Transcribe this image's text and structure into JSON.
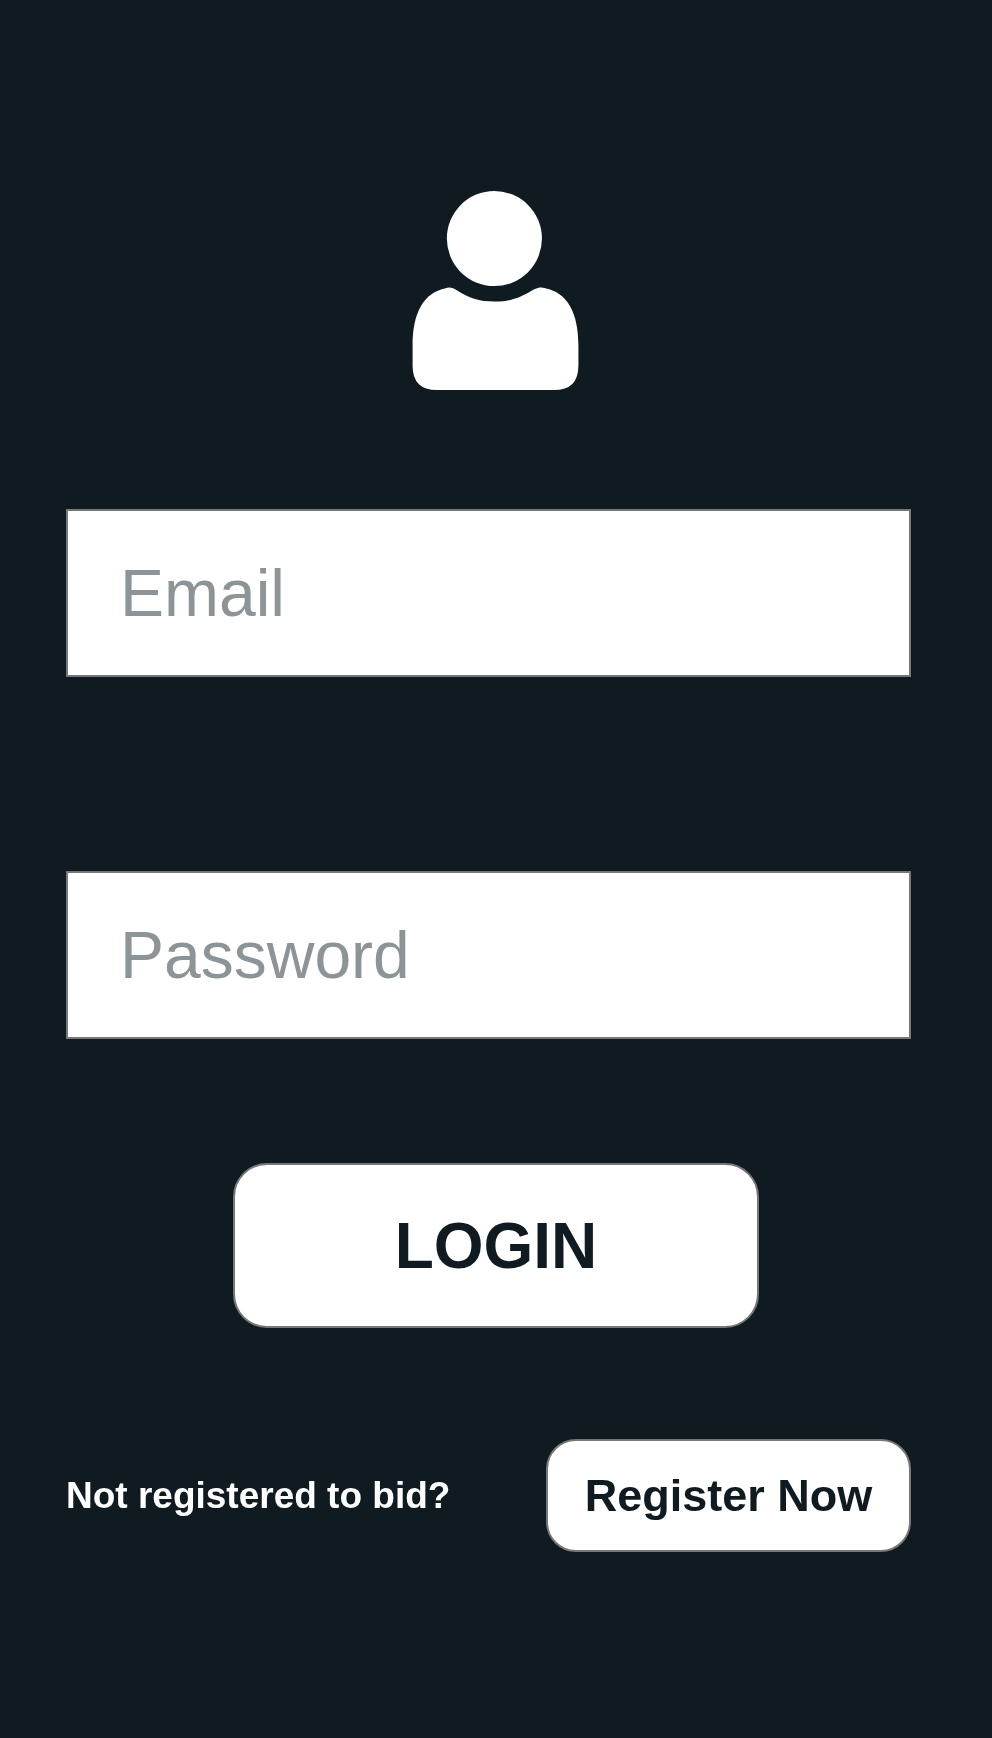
{
  "fields": [
    {
      "placeholder": "Email"
    },
    {
      "placeholder": "Password"
    }
  ],
  "login_button": "LOGIN",
  "register": {
    "prompt": "Not registered to bid?",
    "button": "Register Now"
  }
}
